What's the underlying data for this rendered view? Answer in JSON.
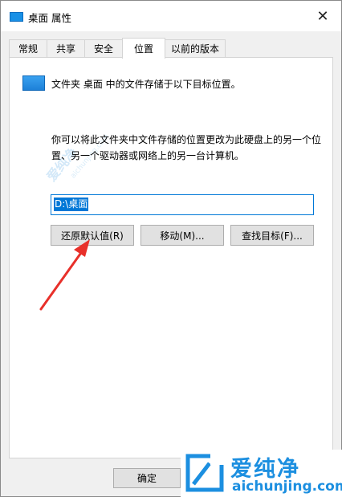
{
  "window": {
    "title": "桌面 属性",
    "close_glyph": "✕"
  },
  "tabs": [
    {
      "label": "常规"
    },
    {
      "label": "共享"
    },
    {
      "label": "安全"
    },
    {
      "label": "位置",
      "active": true
    },
    {
      "label": "以前的版本"
    }
  ],
  "location": {
    "info": "文件夹 桌面 中的文件存储于以下目标位置。",
    "description": "你可以将此文件夹中文件存储的位置更改为此硬盘上的另一个位置、另一个驱动器或网络上的另一台计算机。",
    "path": "D:\\桌面",
    "restore_button": "还原默认值(R)",
    "move_button": "移动(M)...",
    "find_target_button": "查找目标(F)..."
  },
  "footer": {
    "ok_button": "确定"
  },
  "watermark": {
    "cn": "爱纯净",
    "en": "aichunjing.com"
  },
  "brand": {
    "cn": "爱纯净",
    "en": "aichunjing.com",
    "color": "#1c8fe0"
  },
  "annotation": {
    "arrow_color": "#e8302a"
  }
}
